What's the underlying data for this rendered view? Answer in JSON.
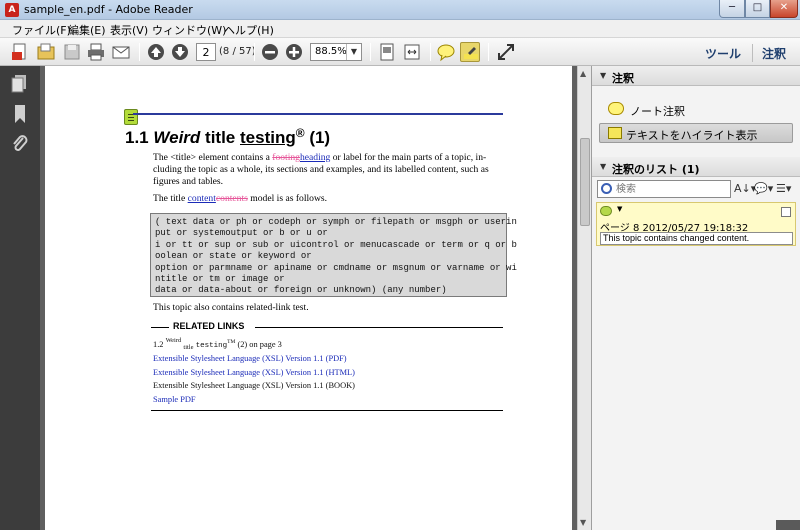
{
  "window": {
    "title": "sample_en.pdf - Adobe Reader",
    "min_glyph": "─",
    "max_glyph": "□",
    "close_glyph": "✕"
  },
  "menu": [
    "ファイル(F)",
    "編集(E)",
    "表示(V)",
    "ウィンドウ(W)",
    "ヘルプ(H)"
  ],
  "toolbar": {
    "page_value": "2",
    "page_count": "(8 / 57)",
    "zoom": "88.5%",
    "tools_label": "ツール",
    "comment_label": "注釈"
  },
  "document": {
    "heading": {
      "number": "1.1",
      "word_italic": "Weird",
      "word_plain": "title",
      "word_underlined": "testing",
      "reg_mark": "®",
      "suffix": "(1)"
    },
    "p1": {
      "before": "The <title> element contains a ",
      "deleted": "footing",
      "inserted": "heading",
      "after": " or label for the main parts of a topic, in-",
      "line2": "cluding the topic as a whole, its sections and examples, and its labelled content, such as",
      "line3": "figures and tables."
    },
    "p2": {
      "before": "The title ",
      "inserted": "content",
      "deleted": "contents",
      "after": " model is as follows."
    },
    "code": "( text data or ph or codeph or symph or filepath or msgph or userin\nput or systemoutput or b or u or\ni or tt or sup or sub or uicontrol or menucascade or term or q or b\noolean or state or keyword or\noption or parmname or apiname or cmdname or msgnum or varname or wi\nntitle or tm or image or\ndata or data-about or foreign or unknown) (any number)",
    "p3": "This topic also contains related-link test.",
    "related_title": "RELATED LINKS",
    "related": {
      "link1_num": "1.2",
      "link1_a": "Weird",
      "link1_b": "title",
      "link1_c": "testing",
      "link1_tm": "TM",
      "link1_tail": "(2) on page 3",
      "link2": "Extensible Stylesheet Language (XSL) Version 1.1 (PDF)",
      "link3": "Extensible Stylesheet Language (XSL) Version 1.1 (HTML)",
      "link4": "Extensible Stylesheet Language (XSL) Version 1.1 (BOOK)",
      "link5": "Sample PDF"
    }
  },
  "panel": {
    "annot_title": "注釈",
    "note_tool": "ノート注釈",
    "highlight_tool": "テキストをハイライト表示",
    "list_title": "注釈のリスト (1)",
    "search_placeholder": "検索",
    "comment": {
      "meta": "ページ 8  2012/05/27 19:18:32",
      "text": "This topic contains changed content."
    }
  },
  "colors": {
    "heading_rule": "#2b3a9c",
    "deleted_text": "#e6579a",
    "inserted_text": "#1b2bb8",
    "note_icon": "#b3dc3a",
    "comment_card": "#fffbc8"
  }
}
